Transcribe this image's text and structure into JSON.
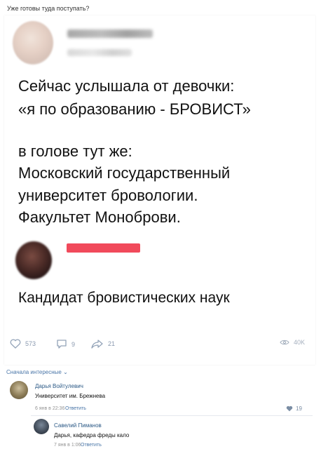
{
  "caption": "Уже готовы туда поступать?",
  "post": {
    "lines": [
      "Сейчас услышала от девочки:",
      "«я по образованию - БРОВИСТ»",
      "",
      "в голове тут же:",
      "Московский государственный",
      "университет бровологии.",
      "Факультет Моноброви."
    ],
    "reply_text": "Кандидат бровистических наук"
  },
  "actions": {
    "likes": "573",
    "comments": "9",
    "shares": "21",
    "views": "40K"
  },
  "comments_sort": "Сначала интересные ⌄",
  "comments": [
    {
      "author": "Дарья Войтулевич",
      "text": "Университет им. Брежнева",
      "time": "6 янв в 22:36",
      "reply_label": "Ответить",
      "likes": "19"
    },
    {
      "author": "Савелий Пиманов",
      "text": "Дарья, кафедра фреды кало",
      "time": "7 янв в 1:06",
      "reply_label": "Ответить"
    }
  ],
  "colors": {
    "accent": "#4a76a8",
    "redacted_name": "#f14a5b",
    "meta": "#939393"
  }
}
